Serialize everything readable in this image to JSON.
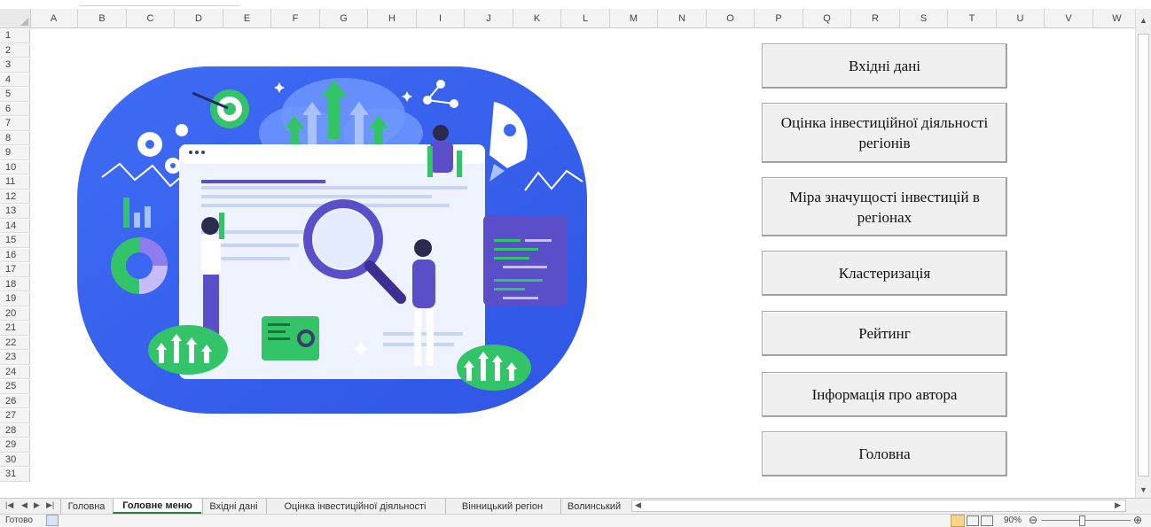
{
  "columns": [
    "A",
    "B",
    "C",
    "D",
    "E",
    "F",
    "G",
    "H",
    "I",
    "J",
    "K",
    "L",
    "M",
    "N",
    "O",
    "P",
    "Q",
    "R",
    "S",
    "T",
    "U",
    "V",
    "W"
  ],
  "rows": [
    "1",
    "2",
    "3",
    "4",
    "5",
    "6",
    "7",
    "8",
    "9",
    "10",
    "11",
    "12",
    "13",
    "14",
    "15",
    "16",
    "17",
    "18",
    "19",
    "20",
    "21",
    "22",
    "23",
    "24",
    "25",
    "26",
    "27",
    "28",
    "29",
    "30",
    "31"
  ],
  "buttons": [
    {
      "label": "Вхідні дані"
    },
    {
      "label": "Оцінка інвестиційної діяльності регіонів"
    },
    {
      "label": "Міра значущості інвестицій в регіонах"
    },
    {
      "label": "Кластеризація"
    },
    {
      "label": "Рейтинг"
    },
    {
      "label": "Інформація про автора"
    },
    {
      "label": "Головна"
    }
  ],
  "sheet_tabs": [
    {
      "label": "Головна",
      "active": false
    },
    {
      "label": "Головне меню",
      "active": true
    },
    {
      "label": "Вхідні дані",
      "active": false
    },
    {
      "label": "Оцінка інвестиційної діяльності",
      "active": false
    },
    {
      "label": "Вінницький регіон",
      "active": false
    },
    {
      "label": "Волинський",
      "active": false
    }
  ],
  "status": {
    "ready": "Готово",
    "zoom": "90%"
  },
  "colors": {
    "illustration_bg": "#3a68f2",
    "accent_green": "#33c46a",
    "accent_purple": "#5b4fc9"
  }
}
